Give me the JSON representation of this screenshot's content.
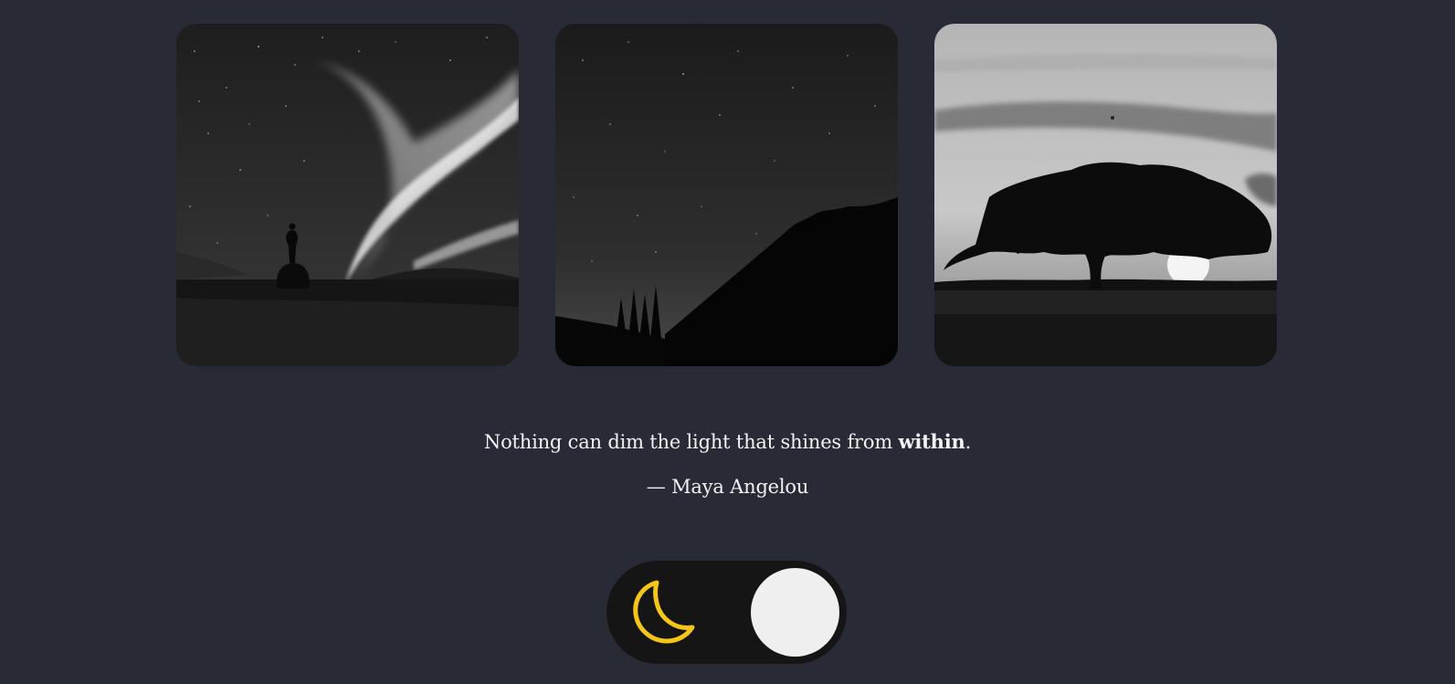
{
  "gallery": {
    "images": [
      {
        "subject": "aurora-over-lone-figure",
        "tone": "grayscale"
      },
      {
        "subject": "starry-night-over-mountain-and-pines",
        "tone": "grayscale"
      },
      {
        "subject": "acacia-tree-at-sunset",
        "tone": "grayscale"
      }
    ]
  },
  "quote": {
    "text_before": "Nothing can dim the light that shines from ",
    "emphasis": "within",
    "text_after": ".",
    "author": "— Maya Angelou"
  },
  "theme_toggle": {
    "mode": "dark",
    "icon": "moon-icon",
    "icon_color": "#f5c518",
    "track_color": "#151516",
    "knob_color": "#efefef"
  },
  "colors": {
    "background": "#282a35",
    "text": "#f2f2f2"
  }
}
